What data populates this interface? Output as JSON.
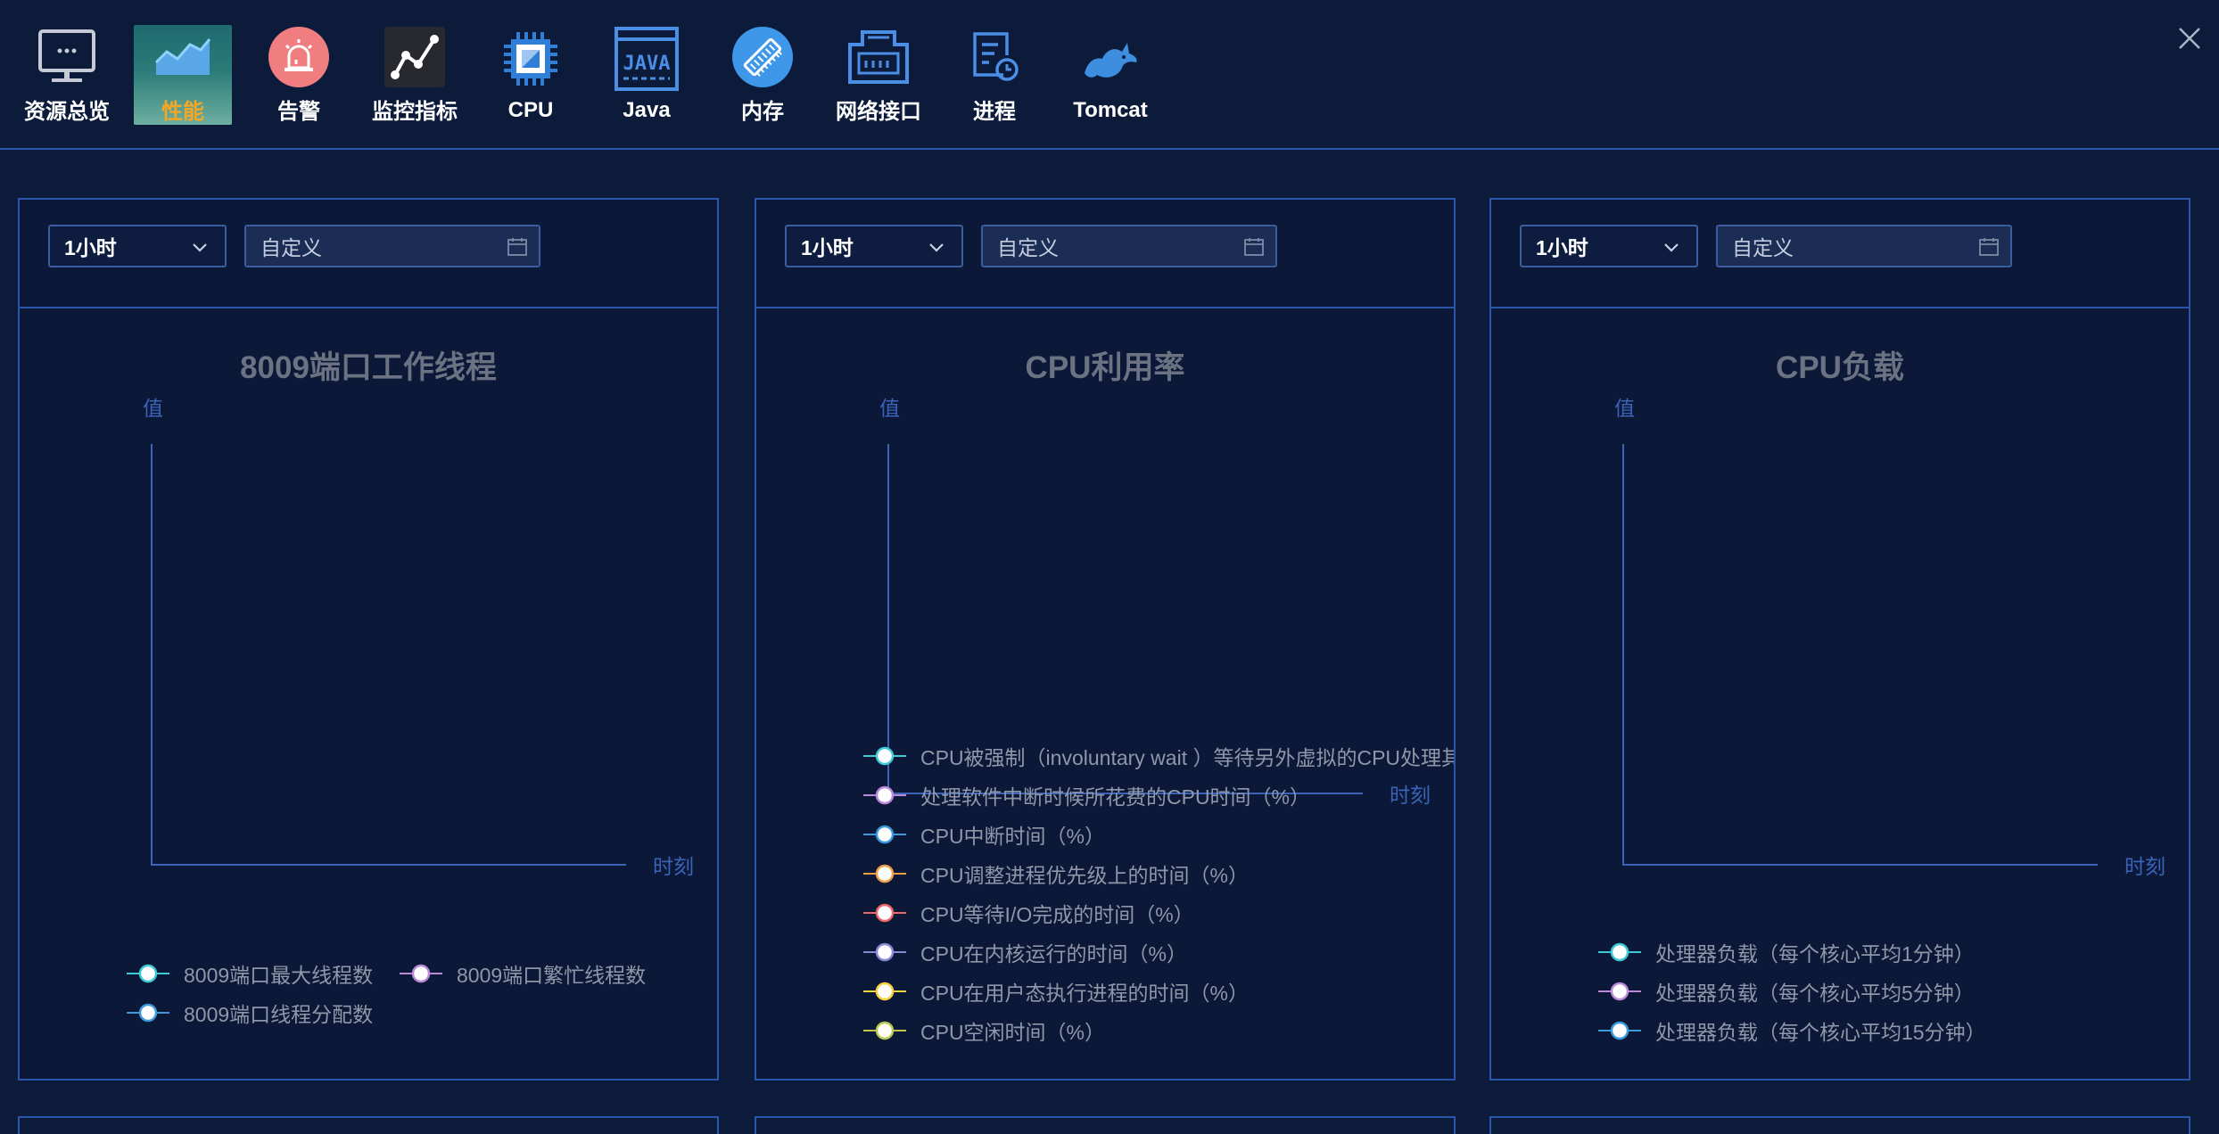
{
  "toolbar": {
    "items": [
      {
        "label": "资源总览",
        "icon": "monitor-icon"
      },
      {
        "label": "性能",
        "icon": "area-chart-icon",
        "active": true
      },
      {
        "label": "告警",
        "icon": "alarm-icon"
      },
      {
        "label": "监控指标",
        "icon": "line-chart-icon"
      },
      {
        "label": "CPU",
        "icon": "cpu-chip-icon"
      },
      {
        "label": "Java",
        "icon": "java-icon"
      },
      {
        "label": "内存",
        "icon": "memory-icon"
      },
      {
        "label": "网络接口",
        "icon": "network-interface-icon"
      },
      {
        "label": "进程",
        "icon": "process-icon"
      },
      {
        "label": "Tomcat",
        "icon": "tomcat-icon"
      }
    ],
    "close_icon": "close-icon"
  },
  "panels": [
    {
      "range": "1小时",
      "date_placeholder": "自定义",
      "title": "8009端口工作线程",
      "y_label": "值",
      "x_label": "时刻",
      "legend": [
        {
          "label": "8009端口最大线程数",
          "color": "#3ec9d6"
        },
        {
          "label": "8009端口繁忙线程数",
          "color": "#b98ad8"
        },
        {
          "label": "8009端口线程分配数",
          "color": "#3a9bdc"
        }
      ]
    },
    {
      "range": "1小时",
      "date_placeholder": "自定义",
      "title": "CPU利用率",
      "y_label": "值",
      "x_label": "时刻",
      "legend": [
        {
          "label": "CPU被强制（involuntary wait ）等待另外虚拟的CPU处理其它程序的时间（%）",
          "color": "#3ec9d6"
        },
        {
          "label": "处理软件中断时候所花费的CPU时间（%）",
          "color": "#b98ad8"
        },
        {
          "label": "CPU中断时间（%）",
          "color": "#3a9bdc"
        },
        {
          "label": "CPU调整进程优先级上的时间（%）",
          "color": "#f0a044"
        },
        {
          "label": "CPU等待I/O完成的时间（%）",
          "color": "#e8686b"
        },
        {
          "label": "CPU在内核运行的时间（%）",
          "color": "#8a86d8"
        },
        {
          "label": "CPU在用户态执行进程的时间（%）",
          "color": "#f2d43c"
        },
        {
          "label": "CPU空闲时间（%）",
          "color": "#b8c94a"
        }
      ]
    },
    {
      "range": "1小时",
      "date_placeholder": "自定义",
      "title": "CPU负载",
      "y_label": "值",
      "x_label": "时刻",
      "legend": [
        {
          "label": "处理器负载（每个核心平均1分钟）",
          "color": "#3ec9d6"
        },
        {
          "label": "处理器负载（每个核心平均5分钟）",
          "color": "#b98ad8"
        },
        {
          "label": "处理器负载（每个核心平均15分钟）",
          "color": "#3a9bdc"
        }
      ]
    }
  ]
}
